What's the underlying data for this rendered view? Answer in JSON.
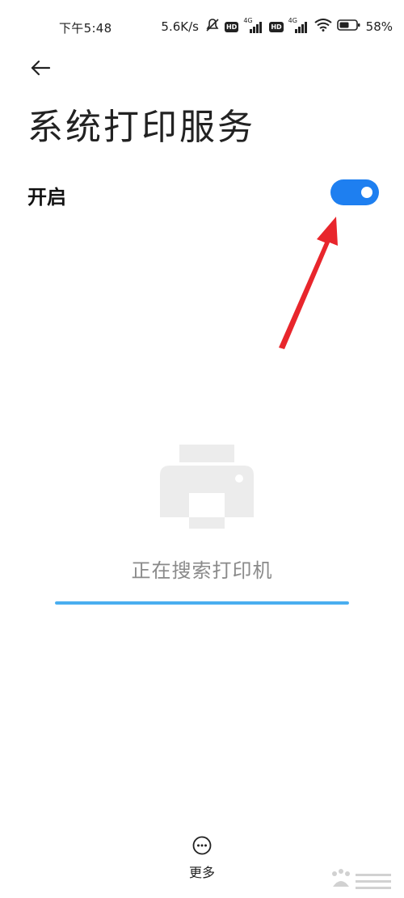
{
  "status_bar": {
    "time": "下午5:48",
    "net_speed": "5.6K/s",
    "hd1": "HD",
    "hd2": "HD",
    "lte1": "4G",
    "lte2": "4G",
    "battery_percent": "58%",
    "battery_level": 0.58
  },
  "header": {
    "back_icon": "arrow-left-icon",
    "title": "系统打印服务"
  },
  "toggle": {
    "label": "开启",
    "state": "on",
    "color": "#1e7ff0"
  },
  "annotation": {
    "arrow_color": "#e8262c"
  },
  "empty_state": {
    "icon": "printer-icon",
    "text": "正在搜索打印机",
    "progress_color": "#49aef0",
    "progress": 1.0
  },
  "bottom": {
    "more_icon": "more-circle-icon",
    "more_label": "更多"
  }
}
